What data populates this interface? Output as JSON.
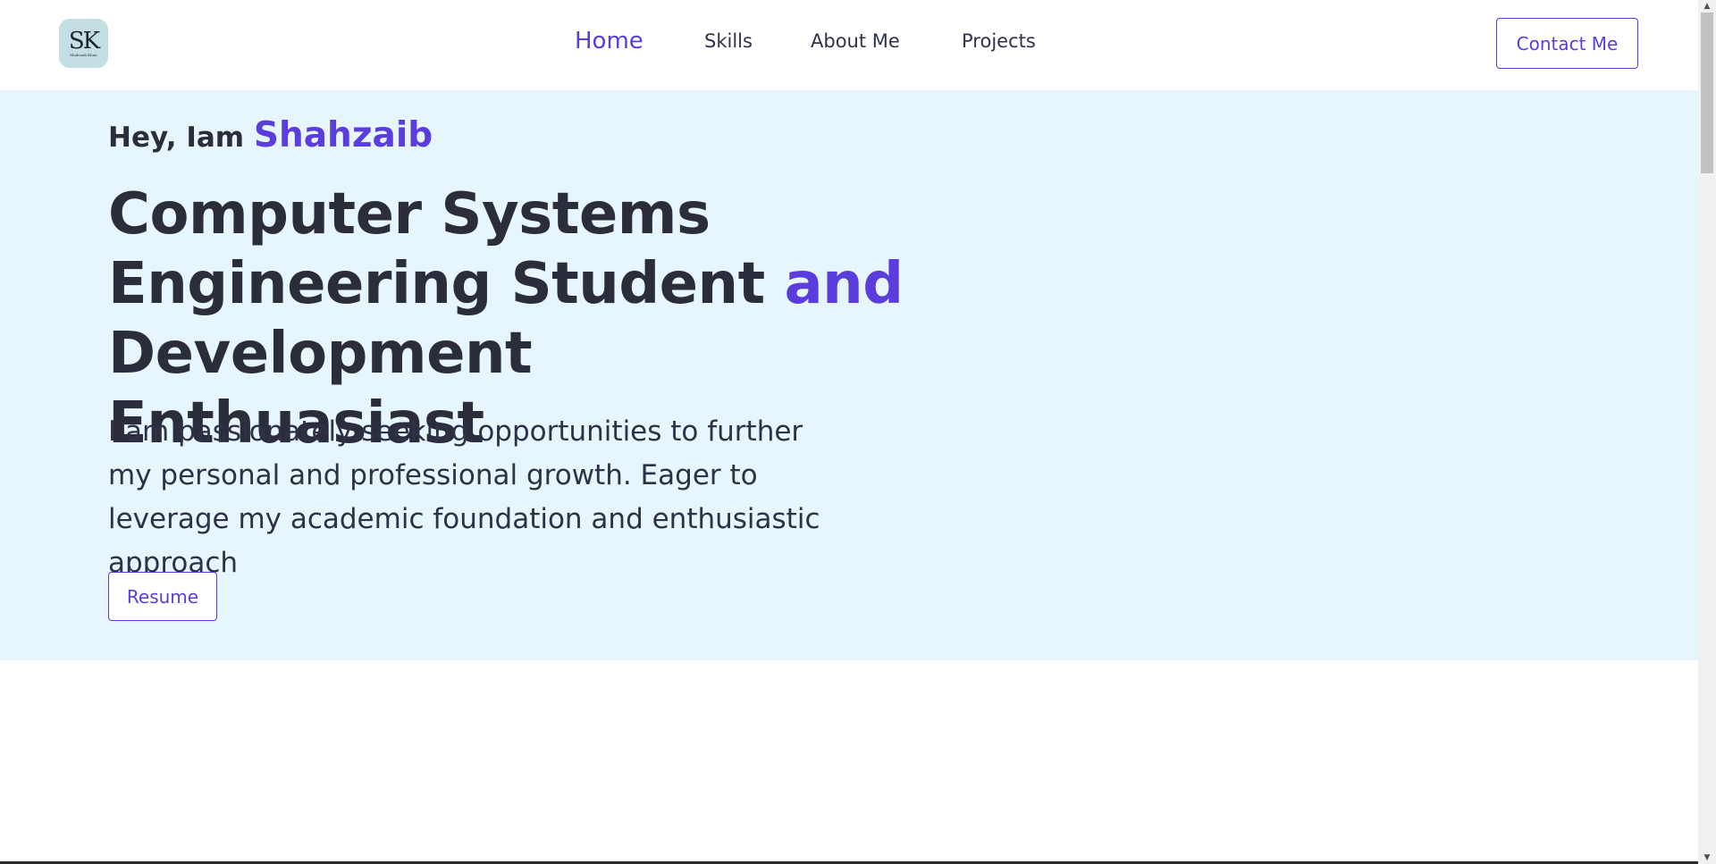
{
  "navbar": {
    "logo": {
      "mark": "SK",
      "subtitle": "Shahzaib Khan"
    },
    "links": [
      {
        "label": "Home",
        "active": true
      },
      {
        "label": "Skills",
        "active": false
      },
      {
        "label": "About Me",
        "active": false
      },
      {
        "label": "Projects",
        "active": false
      }
    ],
    "contact_label": "Contact Me"
  },
  "hero": {
    "greeting_prefix": "Hey, Iam",
    "greeting_name": "Shahzaib",
    "headline_part1": "Computer Systems Engineering Student ",
    "headline_accent": "and",
    "headline_part2": " Development Enthuasiast",
    "intro": "I am passionately seeking opportunities to further my personal and professional growth. Eager to leverage my academic foundation and enthusiastic approach",
    "resume_label": "Resume"
  },
  "scrollbar": {
    "up_icon": "triangle-up-icon",
    "down_icon": "triangle-down-icon"
  },
  "colors": {
    "accent": "#5b3cdc",
    "hero_background": "#e6f6fc",
    "text": "#2b2d3c",
    "logo_background": "#c3dfe4"
  }
}
